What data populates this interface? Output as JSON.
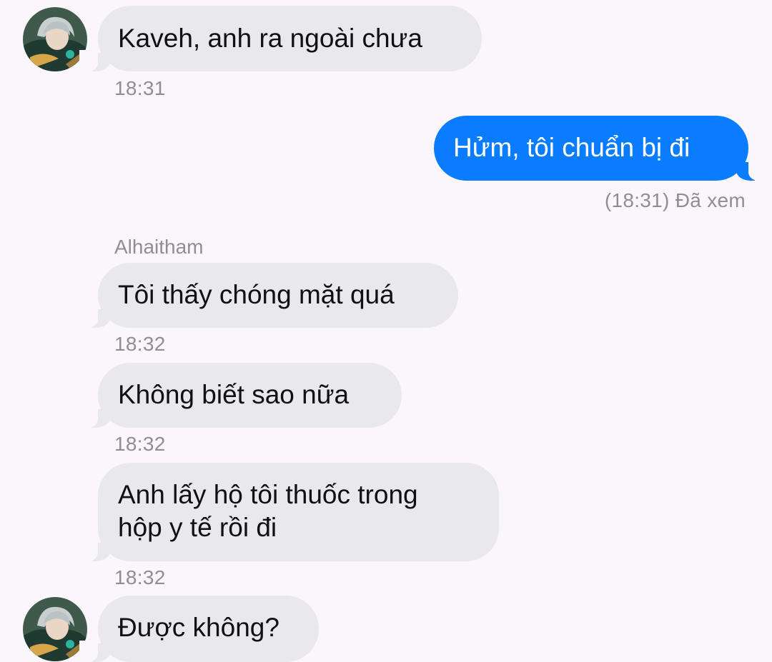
{
  "colors": {
    "background": "#fbf6fc",
    "incoming_bubble": "#e8e8ed",
    "outgoing_bubble": "#0a7cff",
    "meta_text": "#8e8e93"
  },
  "messages": [
    {
      "text": "Kaveh, anh ra ngoài chưa",
      "time": "18:31"
    },
    {
      "text": "Hửm, tôi chuẩn bị đi",
      "status": "(18:31) Đã xem"
    },
    {
      "sender": "Alhaitham",
      "text": "Tôi thấy chóng mặt quá",
      "time": "18:32"
    },
    {
      "text": "Không biết sao nữa",
      "time": "18:32"
    },
    {
      "text": "Anh lấy hộ tôi thuốc trong hộp y tế rồi đi",
      "line1": "Anh lấy hộ tôi thuốc trong",
      "line2": "hộp y tế rồi đi",
      "time": "18:32"
    },
    {
      "text": "Được không?"
    }
  ],
  "avatar_icon": "contact-avatar-photo"
}
